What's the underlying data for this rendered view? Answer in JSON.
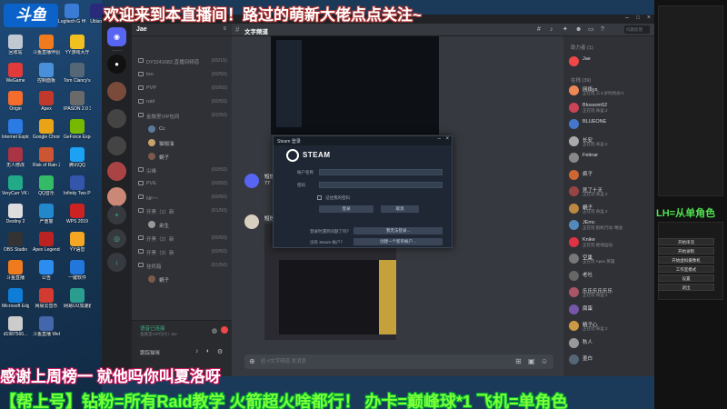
{
  "desktop": {
    "logo": "斗鱼",
    "icons": [
      {
        "label": "Logitech G HUB",
        "color": "#3a7bd5"
      },
      {
        "label": "Ubisoft",
        "color": "#2a2a7a"
      },
      {
        "label": "回收站",
        "color": "#c0c8d0"
      },
      {
        "label": "斗鱼直播伴侣",
        "color": "#f07b1e"
      },
      {
        "label": "YY游戏大厅",
        "color": "#f0c020"
      },
      {
        "label": "WeGame",
        "color": "#e03a3a"
      },
      {
        "label": "控制面板",
        "color": "#4a90d9"
      },
      {
        "label": "Tom Clancy's R...",
        "color": "#556677"
      },
      {
        "label": "Origin",
        "color": "#f56c2d"
      },
      {
        "label": "Apex",
        "color": "#c0392b"
      },
      {
        "label": "IPASON 2.0 317打印机",
        "color": "#6a6a6a"
      },
      {
        "label": "Internet Explorer",
        "color": "#2c7be5"
      },
      {
        "label": "Google Chrome",
        "color": "#e8a317"
      },
      {
        "label": "GeForce Experience",
        "color": "#76b900"
      },
      {
        "label": "无人修改",
        "color": "#aa3344"
      },
      {
        "label": "Risk of Rain 2",
        "color": "#cc5533"
      },
      {
        "label": "腾讯QQ",
        "color": "#1da1f2"
      },
      {
        "label": "VeryCurr VK 动画器",
        "color": "#22aa88"
      },
      {
        "label": "QQ音乐",
        "color": "#33bb66"
      },
      {
        "label": "Infinity Two Pro",
        "color": "#3355aa"
      },
      {
        "label": "Destiny 2",
        "color": "#dddddd"
      },
      {
        "label": "严重警",
        "color": "#2288cc"
      },
      {
        "label": "WPS 2019",
        "color": "#cc2222"
      },
      {
        "label": "OBS Studio",
        "color": "#333333"
      },
      {
        "label": "Apex Legends",
        "color": "#bb2222"
      },
      {
        "label": "YY语音",
        "color": "#f5a623"
      },
      {
        "label": "斗鱼直播",
        "color": "#f07b1e"
      },
      {
        "label": "公告",
        "color": "#2d8cf0"
      },
      {
        "label": "一键软件",
        "color": "#2277dd"
      },
      {
        "label": "Microsoft Edge",
        "color": "#0f7dd8"
      },
      {
        "label": "网易云音乐",
        "color": "#d33a31"
      },
      {
        "label": "网易UU加速器",
        "color": "#2a9d8f"
      },
      {
        "label": "d1987566...",
        "color": "#cccccc"
      },
      {
        "label": "斗鱼直播 WeGame修",
        "color": "#4466aa"
      }
    ]
  },
  "overlay": {
    "welcome": "欢迎来到本直播间！路过的萌新大佬点点关注~",
    "thanks": "感谢上周榜一 就他吗你叫夏洛呀",
    "ticker": "【帮上号】钻粉=所有Raid教学 火箭超火啥都行！ 办卡=巅峰球*1 飞机=单角色",
    "side_green": "LH=从单角色"
  },
  "discord": {
    "server_name": "Jae",
    "channels": [
      {
        "name": "DY3241682,直播间频道",
        "count": "(00/15)",
        "type": "voice"
      },
      {
        "name": "too",
        "count": "(00/50)",
        "type": "voice"
      },
      {
        "name": "PVP",
        "count": "(00/50)",
        "type": "voice"
      },
      {
        "name": "raid",
        "count": "(00/50)",
        "type": "voice"
      },
      {
        "name": "金融室VIP包间",
        "count": "(02/50)",
        "type": "voice"
      }
    ],
    "voice_users_1": [
      "Cc",
      "猫咖油",
      "蜗子"
    ],
    "channels2": [
      {
        "name": "尖峰",
        "count": "(00/50)",
        "type": "voice"
      },
      {
        "name": "PVE",
        "count": "(00/50)",
        "type": "voice"
      },
      {
        "name": "NF～",
        "count": "(00/50)",
        "type": "voice"
      },
      {
        "name": "开黑（1）新",
        "count": "(01/50)",
        "type": "voice"
      }
    ],
    "voice_users_2": [
      "余生"
    ],
    "channels3": [
      {
        "name": "开黑（2）新",
        "count": "(00/50)",
        "type": "voice"
      },
      {
        "name": "开黑（3）新",
        "count": "(00/50)",
        "type": "voice"
      },
      {
        "name": "挂机箱",
        "count": "(01/50)",
        "type": "voice"
      }
    ],
    "voice_users_3": [
      "蜗子"
    ],
    "voice_status": "语音已连接",
    "voice_sub": "金融室VIP包间 / Jae",
    "user_name": "跟踪猫咪",
    "chat_title": "文字频道",
    "search_placeholder": "问题反馈",
    "messages": [
      {
        "name": "短信",
        "text": "77"
      },
      {
        "name": "短信",
        "text": ""
      }
    ],
    "composer_placeholder": "给 #文字频道 发消息",
    "members_header_1": "助力者 (1)",
    "members_header_2": "在线 (39)",
    "members": [
      {
        "name": "Jae",
        "status": "",
        "color": "#f04747"
      },
      {
        "name": "网络ys",
        "status": "正在玩 三十岁时的办人",
        "color": "#ee8855"
      },
      {
        "name": "Blossom52",
        "status": "正在玩 命运 2",
        "color": "#cc4455"
      },
      {
        "name": "BLUEONE",
        "status": "",
        "color": "#4477cc"
      },
      {
        "name": "长安",
        "status": "正在玩 命运 2",
        "color": "#aaaaaa"
      },
      {
        "name": "Fetinar",
        "status": "",
        "color": "#888888"
      },
      {
        "name": "疯子",
        "status": "",
        "color": "#cc6633"
      },
      {
        "name": "死了十天",
        "status": "正在玩 命运 2",
        "color": "#994444"
      },
      {
        "name": "蜗子",
        "status": "正在玩 命运 2",
        "color": "#bb8844"
      },
      {
        "name": "JEmc",
        "status": "正在玩 街机行动: 略总",
        "color": "#5588bb"
      },
      {
        "name": "Knike",
        "status": "正在玩 绝地运动",
        "color": "#dd3344"
      },
      {
        "name": "空巢",
        "status": "正在玩 Apex 英雄",
        "color": "#777777"
      },
      {
        "name": "老吐",
        "status": "",
        "color": "#666666"
      },
      {
        "name": "乐乐乐乐乐乐",
        "status": "正在玩 命运 2",
        "color": "#aa5566"
      },
      {
        "name": "腐蛋",
        "status": "",
        "color": "#7755aa"
      },
      {
        "name": "精子心",
        "status": "正在玩 命运 2",
        "color": "#cc9944"
      },
      {
        "name": "秋人",
        "status": "",
        "color": "#999999"
      },
      {
        "name": "墨白",
        "status": "",
        "color": "#556677"
      }
    ]
  },
  "steam": {
    "window_title": "Steam 登录",
    "brand": "STEAM",
    "account_label": "帐户名称",
    "password_label": "密码",
    "remember_label": "记住我的密码",
    "login_button": "登录",
    "cancel_button": "取消",
    "no_account_q": "没有 Steam 帐户？",
    "create_button": "创建一个新的帐户...",
    "forgot_q": "登录时遇到问题了吗？",
    "help_button": "我无法登录..."
  },
  "obs": {
    "buttons": [
      "开始串流",
      "开始录制",
      "开始虚拟摄像机",
      "工作室模式",
      "设置",
      "退出"
    ]
  }
}
